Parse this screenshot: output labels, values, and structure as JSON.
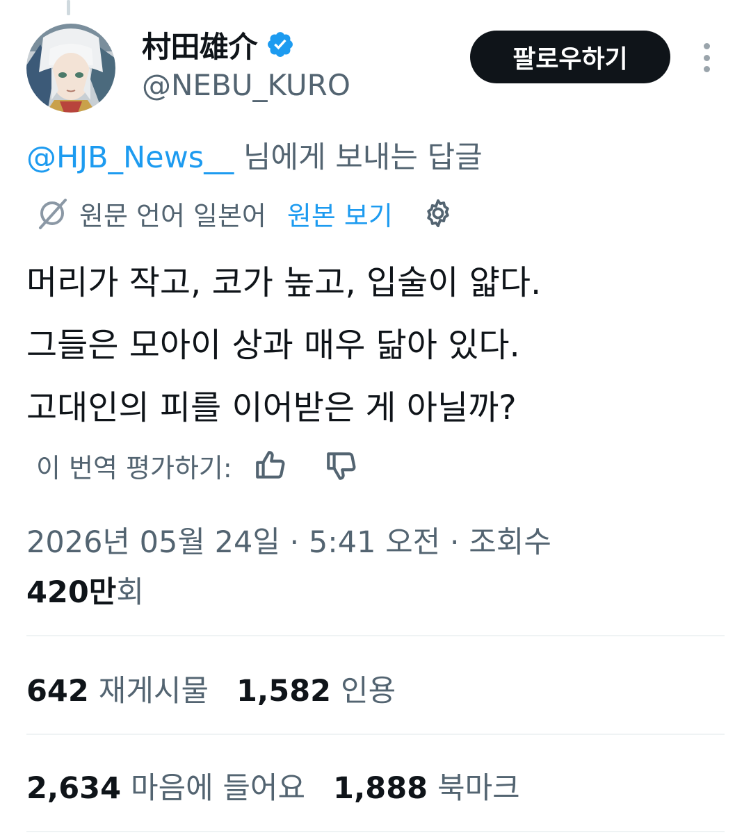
{
  "author": {
    "display_name": "村田雄介",
    "handle": "@NEBU_KURO",
    "verified": true,
    "avatar_icon": "avatar-illustration"
  },
  "follow_button": {
    "label": "팔로우하기"
  },
  "more_button": {
    "icon": "more-vertical-icon"
  },
  "reply_context": {
    "mention": "@HJB_News__",
    "suffix": " 님에게 보내는 답글"
  },
  "translation": {
    "source_text": "원문 언어 일본어",
    "show_original_label": "원본 보기",
    "settings_icon": "gear-icon"
  },
  "tweet": {
    "lines": [
      "머리가 작고, 코가 높고, 입술이 얇다.",
      "그들은 모아이 상과 매우 닮아 있다.",
      "고대인의 피를 이어받은 게 아닐까?"
    ]
  },
  "rate_translation": {
    "label": "이 번역 평가하기:",
    "up_icon": "thumbs-up-icon",
    "down_icon": "thumbs-down-icon"
  },
  "meta": {
    "timestamp": "2026년 05월 24일 · 5:41 오전 · 조회수",
    "views_count": "420만",
    "views_unit": "회"
  },
  "stats": {
    "reposts": {
      "count": "642",
      "label": "재게시물"
    },
    "quotes": {
      "count": "1,582",
      "label": "인용"
    },
    "likes": {
      "count": "2,634",
      "label": "마음에 들어요"
    },
    "bookmarks": {
      "count": "1,888",
      "label": "북마크"
    }
  },
  "colors": {
    "text_primary": "#0f1419",
    "text_secondary": "#536471",
    "link": "#1d9bf0",
    "verified": "#1d9bf0",
    "button_bg": "#0f1419"
  }
}
